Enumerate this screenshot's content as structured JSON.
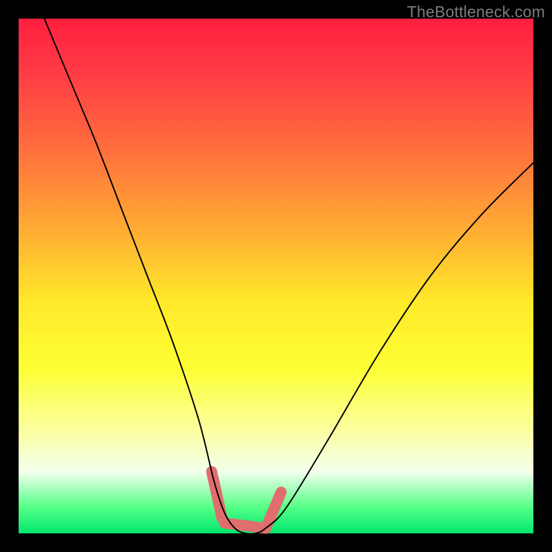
{
  "watermark": "TheBottleneck.com",
  "chart_data": {
    "type": "line",
    "title": "",
    "xlabel": "",
    "ylabel": "",
    "xlim": [
      0,
      100
    ],
    "ylim": [
      0,
      100
    ],
    "grid": false,
    "series": [
      {
        "name": "bottleneck-curve",
        "x": [
          5,
          10,
          15,
          20,
          25,
          30,
          35,
          38,
          40,
          42,
          44,
          46,
          48,
          52,
          60,
          70,
          80,
          90,
          100
        ],
        "y": [
          100,
          88,
          76,
          63,
          50,
          37,
          22,
          10,
          4,
          1,
          0,
          0,
          1,
          5,
          18,
          35,
          50,
          62,
          72
        ]
      }
    ],
    "annotations": [
      {
        "name": "left-tip-nub",
        "x0": 37.5,
        "y0": 12,
        "x1": 39.5,
        "y1": 3
      },
      {
        "name": "bottom-bar-nub",
        "x0": 40,
        "y0": 2,
        "x1": 48,
        "y1": 1
      },
      {
        "name": "right-tip-nub",
        "x0": 48,
        "y0": 1,
        "x1": 51,
        "y1": 8
      }
    ],
    "colors": {
      "curve": "#000000",
      "nub": "#e06e6e"
    }
  }
}
